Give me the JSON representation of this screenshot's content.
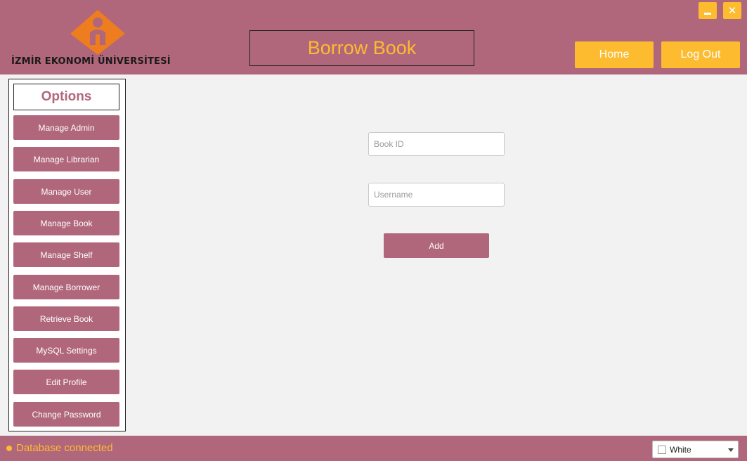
{
  "header": {
    "logo_text": "İZMİR EKONOMİ ÜNİVERSİTESİ",
    "title": "Borrow Book",
    "home_label": "Home",
    "logout_label": "Log Out",
    "minimize_icon": "minimize-icon",
    "close_icon": "close-icon",
    "close_glyph": "✕"
  },
  "sidebar": {
    "heading": "Options",
    "items": [
      {
        "label": "Manage Admin"
      },
      {
        "label": "Manage Librarian"
      },
      {
        "label": "Manage User"
      },
      {
        "label": "Manage Book"
      },
      {
        "label": "Manage Shelf"
      },
      {
        "label": "Manage Borrower"
      },
      {
        "label": "Retrieve Book"
      },
      {
        "label": "MySQL Settings"
      },
      {
        "label": "Edit Profile"
      },
      {
        "label": "Change Password"
      }
    ]
  },
  "form": {
    "book_id_placeholder": "Book ID",
    "book_id_value": "",
    "username_placeholder": "Username",
    "username_value": "",
    "add_label": "Add"
  },
  "footer": {
    "status_text": "Database connected",
    "theme_selected": "White"
  },
  "colors": {
    "primary": "#b0677b",
    "accent": "#fdbb30",
    "background": "#f2f2f2",
    "logo_orange": "#ee7d1f"
  }
}
